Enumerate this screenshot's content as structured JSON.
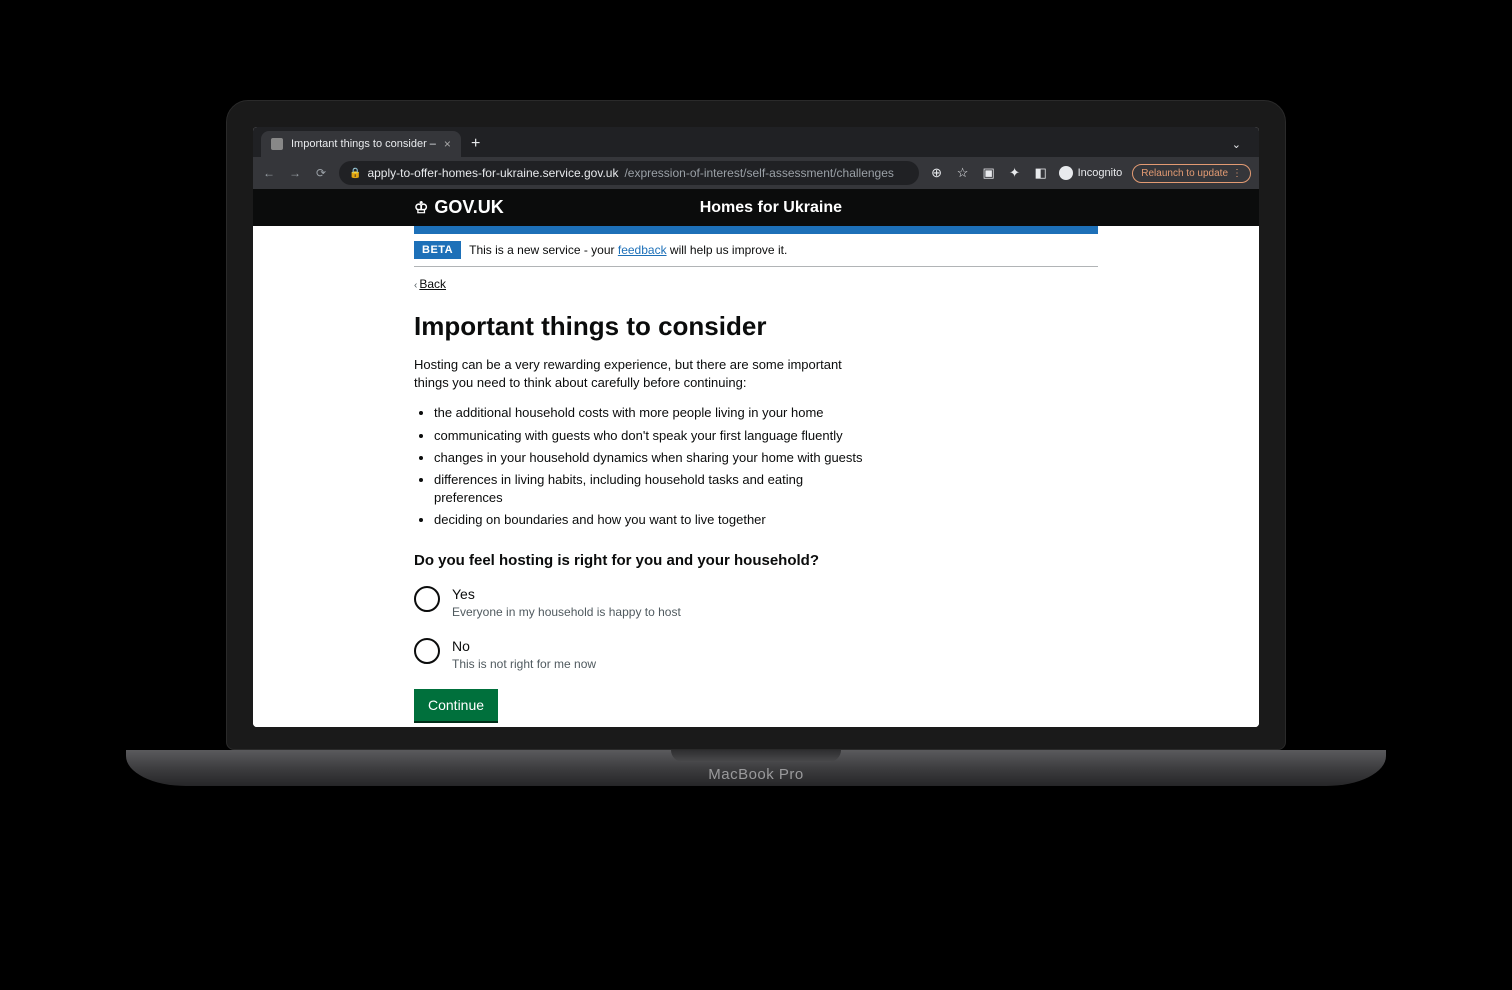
{
  "browser": {
    "tab_title": "Important things to consider –",
    "url_domain": "apply-to-offer-homes-for-ukraine.service.gov.uk",
    "url_path": "/expression-of-interest/self-assessment/challenges",
    "incognito_label": "Incognito",
    "relaunch_label": "Relaunch to update"
  },
  "header": {
    "logo_text": "GOV.UK",
    "service_name": "Homes for Ukraine"
  },
  "phase": {
    "tag": "BETA",
    "text_before": "This is a new service - your ",
    "link": "feedback",
    "text_after": " will help us improve it."
  },
  "back": {
    "label": "Back"
  },
  "main": {
    "heading": "Important things to consider",
    "intro": "Hosting can be a very rewarding experience, but there are some important things you need to think about carefully before continuing:",
    "bullets": [
      "the additional household costs with more people living in your home",
      "communicating with guests who don't speak your first language fluently",
      "changes in your household dynamics when sharing your home with guests",
      "differences in living habits, including household tasks and eating preferences",
      "deciding on boundaries and how you want to live together"
    ],
    "question": "Do you feel hosting is right for you and your household?",
    "options": [
      {
        "label": "Yes",
        "hint": "Everyone in my household is happy to host"
      },
      {
        "label": "No",
        "hint": "This is not right for me now"
      }
    ],
    "continue": "Continue"
  },
  "device": {
    "brand_light": "Mac",
    "brand_bold": "Book Pro"
  }
}
